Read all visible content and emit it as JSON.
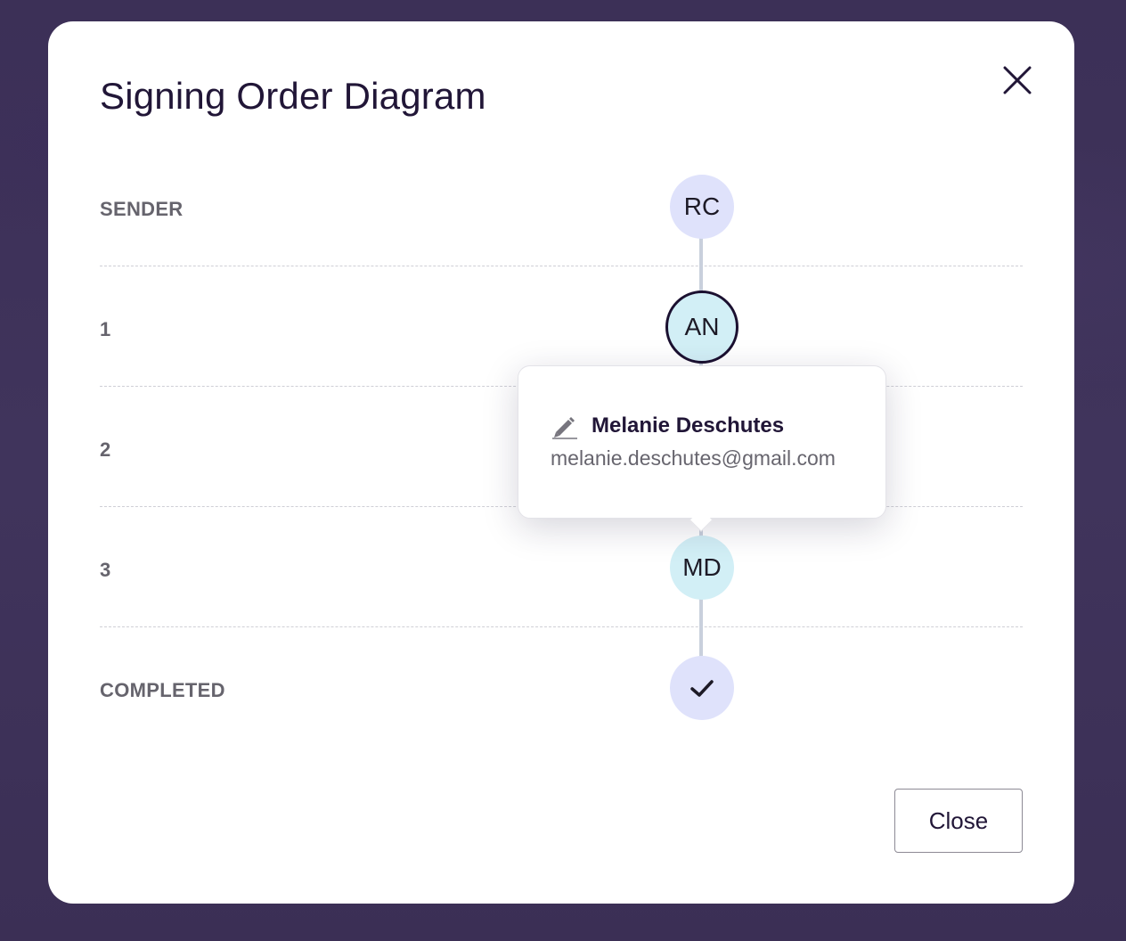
{
  "modal": {
    "title": "Signing Order Diagram",
    "close_button_label": "Close"
  },
  "rows": [
    {
      "label": "SENDER"
    },
    {
      "label": "1"
    },
    {
      "label": "2"
    },
    {
      "label": "3"
    },
    {
      "label": "COMPLETED"
    }
  ],
  "nodes": {
    "sender": "RC",
    "step1": "AN",
    "step3": "MD"
  },
  "tooltip": {
    "name": "Melanie Deschutes",
    "email": "melanie.deschutes@gmail.com"
  },
  "colors": {
    "node_sender": "#dfe2fb",
    "node_signer": "#d2eff6",
    "title_text": "#211637",
    "backdrop": "#3d3158"
  }
}
